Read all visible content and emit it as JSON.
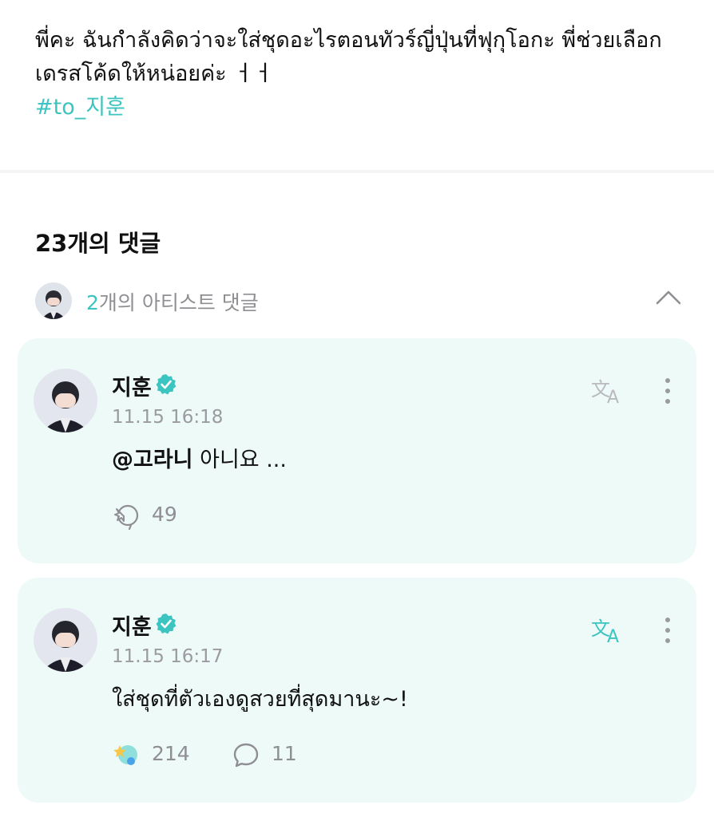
{
  "post": {
    "body": "พี่คะ ฉันกำลังคิดว่าจะใส่ชุดอะไรตอนทัวร์ญี่ปุ่นที่ฟุกุโอกะ พี่ช่วยเลือกเดรสโค้ดให้หน่อยค่ะ ㅓㅓ",
    "hashtag": "#to_지훈"
  },
  "comments_header": {
    "count_label": "23개의 댓글"
  },
  "artist_comments": {
    "count": "2",
    "label_rest": "개의 아티스트 댓글"
  },
  "colors": {
    "accent": "#3cc4c0",
    "card_bg": "#eefaf8",
    "muted": "#8e8e93"
  },
  "comments": [
    {
      "author": "지훈",
      "time": "11.15 16:18",
      "mention": "@고라니",
      "text": " 아니요 ...",
      "reaction_count": "49",
      "reaction_icon": "reaction-empty-icon",
      "translate_icon": "translate-icon"
    },
    {
      "author": "지훈",
      "time": "11.15 16:17",
      "text": "ใส่ชุดที่ตัวเองดูสวยที่สุดมานะ~!",
      "reaction_count": "214",
      "reply_count": "11",
      "reaction_icon": "reaction-filled-icon",
      "translate_icon": "translate-icon"
    }
  ]
}
